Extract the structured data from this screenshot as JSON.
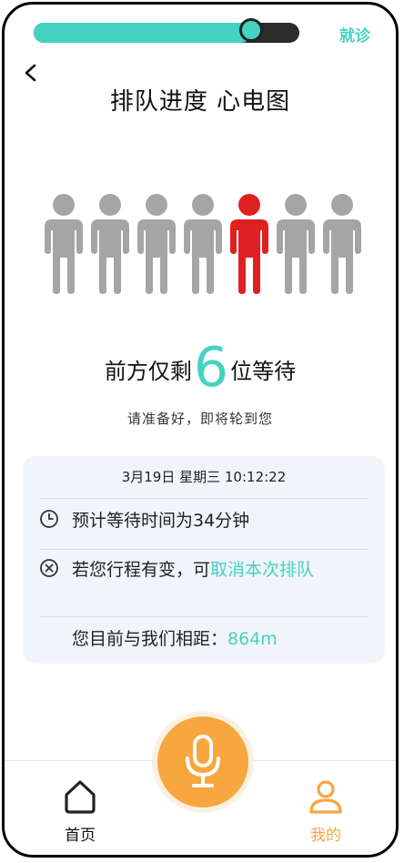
{
  "header": {
    "progress": 0.82,
    "visit_label": "就诊",
    "title": "排队进度 心电图"
  },
  "queue": {
    "people_total": 7,
    "highlight_index": 4,
    "prefix": "前方仅剩",
    "count": "6",
    "suffix": "位等待",
    "note": "请准备好，即将轮到您"
  },
  "card": {
    "date": "3月19日 星期三 10:12:22",
    "wait_text": "预计等待时间为34分钟",
    "change_prefix": "若您行程有变，可",
    "cancel_link": "取消本次排队",
    "distance_prefix": "您目前与我们相距：",
    "distance_value": "864m"
  },
  "nav": {
    "home_label": "首页",
    "mine_label": "我的"
  },
  "colors": {
    "accent": "#45d2c0",
    "highlight": "#e02020",
    "person": "#a5a5a5",
    "orange": "#f8a640"
  },
  "icons": {
    "back": "chevron-left-icon",
    "clock": "clock-icon",
    "cancel": "circle-x-icon",
    "mic": "microphone-icon",
    "home": "home-icon",
    "mine": "user-icon"
  }
}
